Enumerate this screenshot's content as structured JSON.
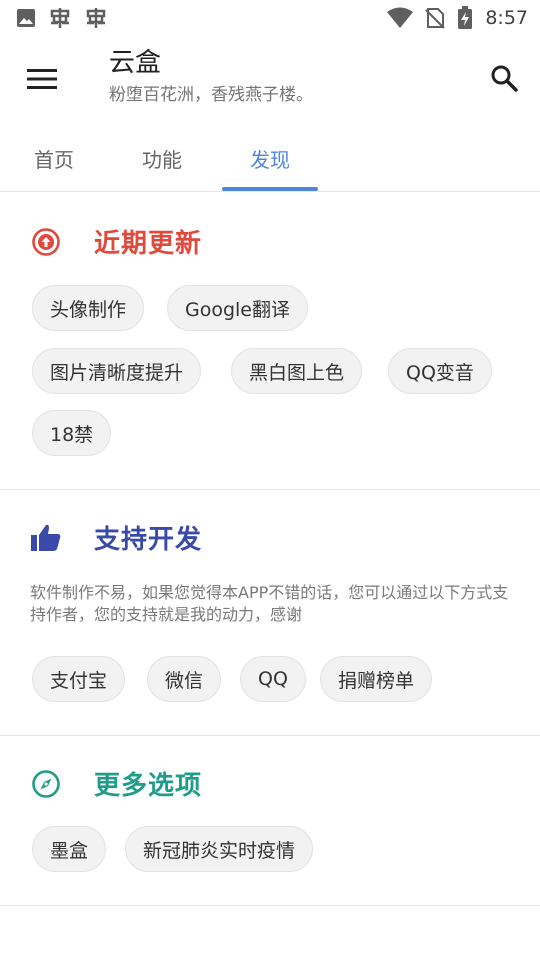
{
  "status_bar": {
    "time": "8:57",
    "left_icons": [
      "image-icon",
      "bug-icon",
      "bug-icon"
    ],
    "right_icons": [
      "wifi-icon",
      "no-sim-icon",
      "battery-charging-icon"
    ]
  },
  "appbar": {
    "title": "云盒",
    "subtitle": "粉堕百花洲，香残燕子楼。"
  },
  "tabs": [
    {
      "label": "首页",
      "active": false
    },
    {
      "label": "功能",
      "active": false
    },
    {
      "label": "发现",
      "active": true
    }
  ],
  "colors": {
    "accent": "#4f86d8",
    "recent": "#e04a3c",
    "support": "#3a4aa8",
    "more": "#1f9d8a"
  },
  "sections": {
    "recent": {
      "title": "近期更新",
      "icon": "arrow-up-circle-icon",
      "chips": [
        "头像制作",
        "Google翻译",
        "图片清晰度提升",
        "黑白图上色",
        "QQ变音",
        "18禁"
      ]
    },
    "support": {
      "title": "支持开发",
      "icon": "thumbs-up-icon",
      "description": "软件制作不易，如果您觉得本APP不错的话，您可以通过以下方式支持作者，您的支持就是我的动力，感谢",
      "chips": [
        "支付宝",
        "微信",
        "QQ",
        "捐赠榜单"
      ]
    },
    "more": {
      "title": "更多选项",
      "icon": "compass-icon",
      "chips": [
        "墨盒",
        "新冠肺炎实时疫情"
      ]
    }
  }
}
